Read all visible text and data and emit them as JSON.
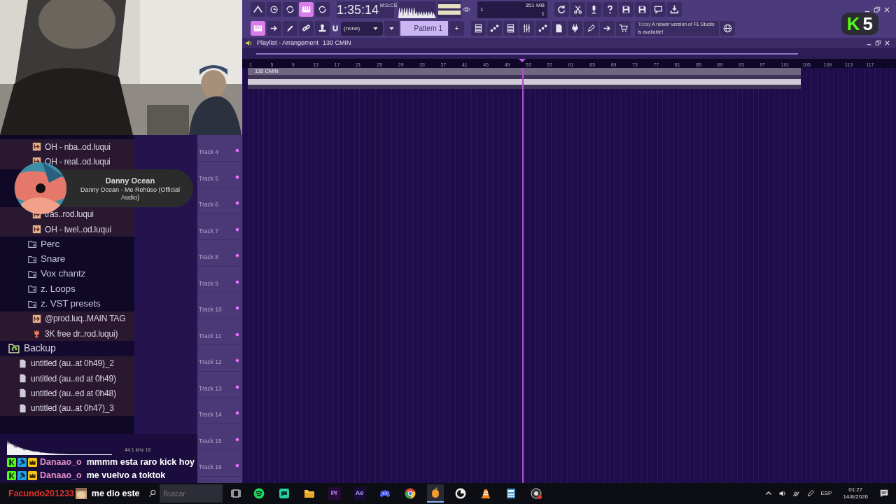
{
  "toolbar": {
    "mode_buttons": [
      {
        "on": false
      },
      {
        "on": false
      },
      {
        "on": false
      },
      {
        "on": true
      },
      {
        "on": false
      }
    ],
    "time": "1:35:14",
    "time_format": "M:S:CS",
    "monitor": {
      "voices": "1",
      "memory": "351 MB",
      "cpu": "1"
    },
    "tool_buttons": [
      {
        "on": true
      },
      {
        "on": false
      },
      {
        "on": false
      },
      {
        "on": false
      },
      {
        "on": false
      }
    ],
    "snap": "(none)",
    "pattern": "Pattern 1",
    "pattern_add": "+",
    "news": {
      "when": "Today",
      "text": "A newer version of FL Studio is available!"
    }
  },
  "stream_badge": {
    "logo": "K",
    "count": "5"
  },
  "playlist": {
    "title": "Playlist - Arrangement",
    "tempo": "130 CMIN",
    "clip_label": "130 CMIN",
    "bars": [
      "1",
      "5",
      "9",
      "13",
      "17",
      "21",
      "25",
      "29",
      "33",
      "37",
      "41",
      "45",
      "49",
      "53",
      "57",
      "61",
      "65",
      "69",
      "73",
      "77",
      "81",
      "85",
      "89",
      "93",
      "97",
      "101",
      "105",
      "109",
      "113",
      "117"
    ],
    "tracks": [
      "Track 4",
      "Track 5",
      "Track 6",
      "Track 7",
      "Track 8",
      "Track 9",
      "Track 10",
      "Track 11",
      "Track 12",
      "Track 13",
      "Track 14",
      "Track 15",
      "Track 16"
    ]
  },
  "browser": {
    "items": [
      {
        "kind": "audio",
        "label": "OH - nba..od.luqui"
      },
      {
        "kind": "audio",
        "label": "OH - real..od.luqui"
      },
      {
        "kind": "now_playing"
      },
      {
        "kind": "audio",
        "label": "tras..rod.luqui"
      },
      {
        "kind": "audio",
        "label": "OH - twel..od.luqui"
      },
      {
        "kind": "folder",
        "label": "Perc"
      },
      {
        "kind": "folder",
        "label": "Snare"
      },
      {
        "kind": "folder",
        "label": "Vox chantz"
      },
      {
        "kind": "folder",
        "label": "z. Loops"
      },
      {
        "kind": "folder",
        "label": "z. VST presets"
      },
      {
        "kind": "audio",
        "label": "@prod.luq..MAIN TAG"
      },
      {
        "kind": "pack",
        "label": "3K free dr..rod.luqui)"
      },
      {
        "kind": "backup",
        "label": "Backup",
        "children": [
          {
            "kind": "file",
            "label": "untitled (au..at 0h49)_2"
          },
          {
            "kind": "file",
            "label": "untitled (au..ed at 0h49)"
          },
          {
            "kind": "file",
            "label": "untitled (au..ed at 0h48)"
          },
          {
            "kind": "file",
            "label": "untitled (au..at 0h47)_3"
          }
        ]
      }
    ]
  },
  "now_playing": {
    "artist": "Danny Ocean",
    "track": "Danny Ocean - Me Rehúso (Official Audio)"
  },
  "preview": {
    "info": "44.1 kHz 16"
  },
  "chat": [
    {
      "user": "Danaao_o",
      "color": "#e58fc4",
      "message": "mmmm esta raro kick hoy",
      "badges": true
    },
    {
      "user": "Danaao_o",
      "color": "#e58fc4",
      "message": "me vuelvo a toktok",
      "badges": true
    }
  ],
  "taskbar": {
    "chat": {
      "user": "Facundo201233",
      "color": "#e0332b",
      "message": "me dio este"
    },
    "search": {
      "placeholder": "Buscar"
    },
    "apps": [
      {
        "kind": "music",
        "selected": false
      },
      {
        "kind": "chat",
        "selected": false
      },
      {
        "kind": "folder",
        "selected": false
      },
      {
        "kind": "tile",
        "label": "Pr",
        "selected": false
      },
      {
        "kind": "tile",
        "label": "Ae",
        "selected": false
      },
      {
        "kind": "controller",
        "selected": false
      },
      {
        "kind": "browser",
        "selected": false
      },
      {
        "kind": "fruit",
        "selected": true
      },
      {
        "kind": "circle",
        "selected": false
      },
      {
        "kind": "cone",
        "selected": false
      },
      {
        "kind": "calculator",
        "selected": false
      },
      {
        "kind": "record",
        "selected": false
      }
    ],
    "language": "ESP",
    "time": "01:27",
    "date": "14/8/2026"
  }
}
